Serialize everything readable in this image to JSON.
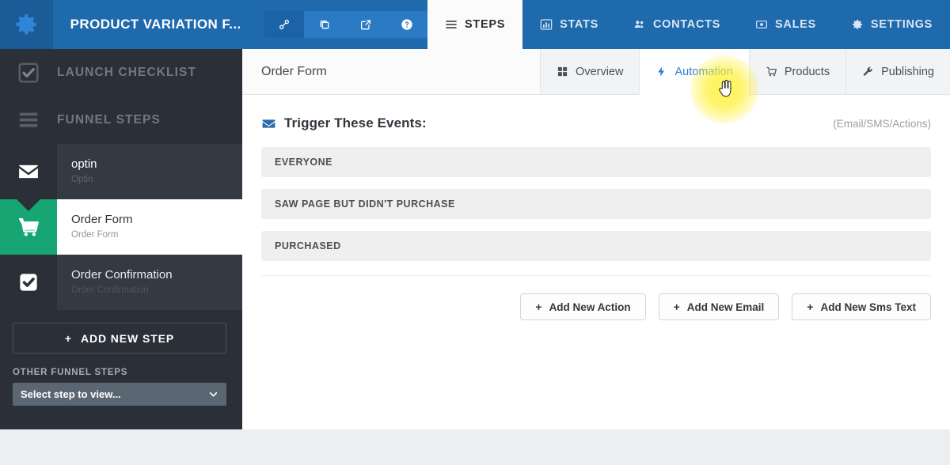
{
  "topbar": {
    "logo_icon": "gear-icon",
    "brand_title": "PRODUCT VARIATION F...",
    "icon_buttons": [
      {
        "name": "link-icon",
        "label": "Link",
        "active": true
      },
      {
        "name": "clone-icon",
        "label": "Clone",
        "active": false
      },
      {
        "name": "external-link-icon",
        "label": "Open",
        "active": false
      },
      {
        "name": "help-icon",
        "label": "Help",
        "active": false
      }
    ],
    "nav_tabs": [
      {
        "label": "STEPS",
        "icon": "hamburger-icon",
        "active": true
      },
      {
        "label": "STATS",
        "icon": "bar-chart-icon",
        "active": false
      },
      {
        "label": "CONTACTS",
        "icon": "people-icon",
        "active": false
      },
      {
        "label": "SALES",
        "icon": "money-icon",
        "active": false
      },
      {
        "label": "SETTINGS",
        "icon": "gear-icon",
        "active": false
      }
    ]
  },
  "sidebar": {
    "launch_checklist": "LAUNCH CHECKLIST",
    "funnel_steps": "FUNNEL STEPS",
    "steps": [
      {
        "title": "optin",
        "subtitle": "Optin",
        "icon": "envelope-icon",
        "state": "visited"
      },
      {
        "title": "Order Form",
        "subtitle": "Order Form",
        "icon": "cart-icon",
        "state": "active"
      },
      {
        "title": "Order Confirmation",
        "subtitle": "Order Confirmation",
        "icon": "check-square-icon",
        "state": "normal"
      }
    ],
    "add_new_step": "ADD NEW STEP",
    "other_funnel_steps_label": "OTHER FUNNEL STEPS",
    "select_placeholder": "Select step to view..."
  },
  "main": {
    "page_title": "Order Form",
    "tabs": [
      {
        "label": "Overview",
        "icon": "grid-icon",
        "active": false
      },
      {
        "label": "Automation",
        "icon": "bolt-icon",
        "active": true
      },
      {
        "label": "Products",
        "icon": "cart-icon",
        "active": false
      },
      {
        "label": "Publishing",
        "icon": "wrench-icon",
        "active": false
      }
    ],
    "trigger_heading": "Trigger These Events:",
    "trigger_note": "(Email/SMS/Actions)",
    "trigger_rows": [
      "EVERYONE",
      "SAW PAGE BUT DIDN'T PURCHASE",
      "PURCHASED"
    ],
    "buttons": [
      {
        "plus": "+",
        "label": "Add New Action"
      },
      {
        "plus": "+",
        "label": "Add New Email"
      },
      {
        "plus": "+",
        "label": "Add New Sms Text"
      }
    ]
  },
  "colors": {
    "topbar_blue": "#1f69ad",
    "logo_panel_blue": "#1a5b98",
    "sidebar_dark": "#2b3038",
    "active_green": "#17a673",
    "accent_blue": "#2b7fd4",
    "highlight_yellow": "#fff340"
  }
}
